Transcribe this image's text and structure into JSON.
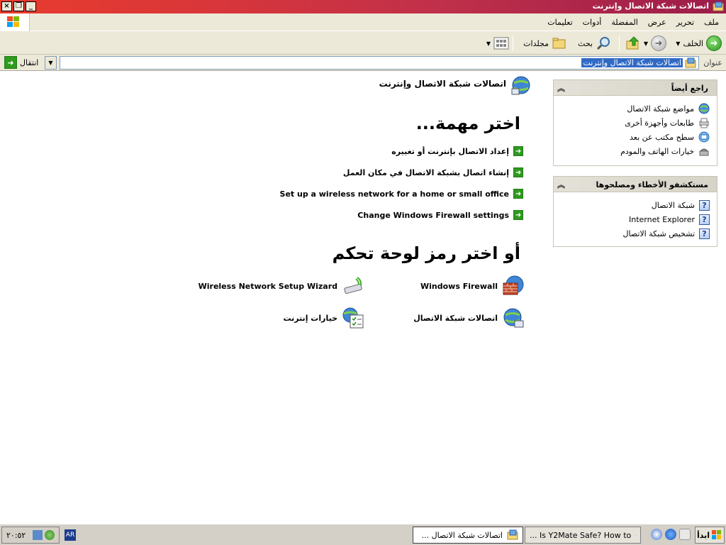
{
  "window": {
    "title": "اتصالات شبكة الاتصال وإنترنت",
    "buttons": {
      "close": "×",
      "restore": "❐",
      "minimize": "_"
    }
  },
  "menu": [
    "ملف",
    "تحرير",
    "عرض",
    "المفضلة",
    "أدوات",
    "تعليمات"
  ],
  "toolbar": {
    "back_label": "الخلف",
    "search_label": "بحث",
    "folders_label": "مجلدات"
  },
  "address": {
    "label": "عنوان",
    "value": "اتصالات شبكة الاتصال وإنترنت",
    "go_label": "انتقال"
  },
  "see_also": {
    "title": "راجع أيضاً",
    "items": [
      "مواضع شبكة الاتصال",
      "طابعات وأجهزة أخرى",
      "سطح مكتب عن بعد",
      "خيارات الهاتف والمودم"
    ]
  },
  "troubleshooters": {
    "title": "مستكشفو الأخطاء ومصلحوها",
    "items": [
      "شبكة الاتصال",
      "Internet Explorer",
      "تشخيص شبكة الاتصال"
    ]
  },
  "main": {
    "title": "اتصالات شبكة الاتصال وإنترنت",
    "pick_task": "اختر مهمة...",
    "tasks": [
      "إعداد الاتصال بإنترنت أو تغييره",
      "إنشاء اتصال بشبكة الاتصال في مكان العمل",
      "Set up a wireless network for a home or small office",
      "Change Windows Firewall settings"
    ],
    "pick_icon": "أو اختر رمز لوحة تحكم",
    "icons": [
      "Windows Firewall",
      "Wireless Network Setup Wizard",
      "اتصالات شبكة الاتصال",
      "خيارات إنترنت"
    ]
  },
  "taskbar": {
    "start": "ابدأ",
    "buttons": [
      "اتصالات شبكة الاتصال ...",
      "Is Y2Mate Safe? How to ..."
    ],
    "lang": "AR",
    "clock": "٢٠:٥٢"
  }
}
